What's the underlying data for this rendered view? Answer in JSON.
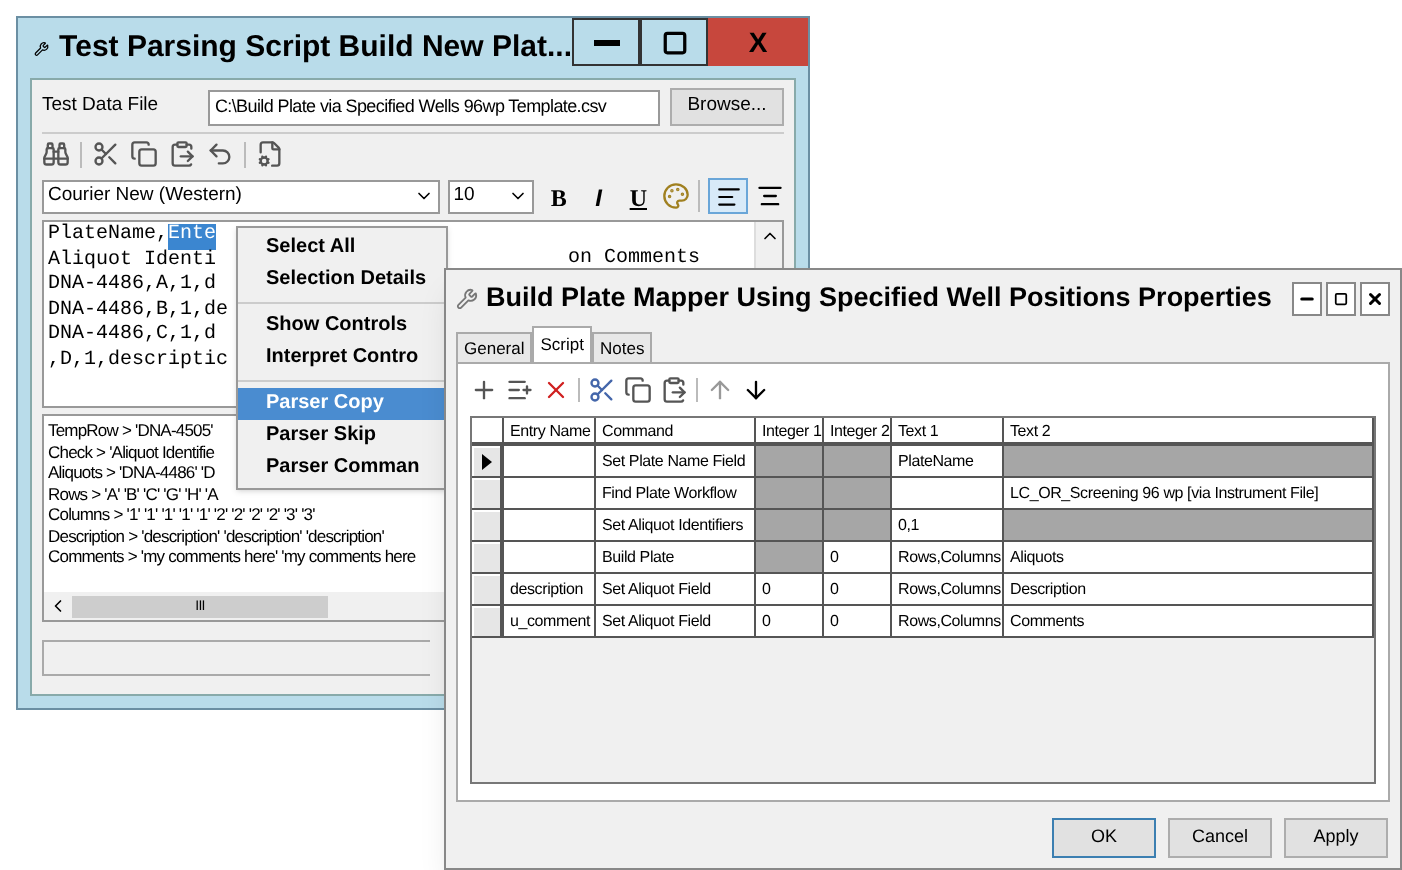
{
  "parser_window": {
    "title": "Test Parsing Script Build New Plat...",
    "close_label": "X",
    "test_data_file": {
      "label": "Test Data File",
      "value": "C:\\Build Plate via Specified Wells 96wp Template.csv",
      "button": "Browse..."
    },
    "font_select": {
      "value": "Courier New (Western)"
    },
    "size_select": {
      "value": "10"
    },
    "format_buttons": [
      {
        "label": "B",
        "kind": "bold"
      },
      {
        "label": "I",
        "kind": "italic"
      },
      {
        "label": "U",
        "kind": "underline"
      }
    ],
    "editor_lines": [
      {
        "text": "PlateName,",
        "selected_text": "Ente"
      },
      {
        "text": "Aliquot Identi"
      },
      {
        "text": "DNA-4486,A,1,d"
      },
      {
        "text": "DNA-4486,B,1,de"
      },
      {
        "text": "DNA-4486,C,1,d"
      },
      {
        "text": ",D,1,descriptic"
      }
    ],
    "editor_overflow_text": "on Comments",
    "log_lines": [
      "TempRow > 'DNA-4505'",
      "Check > 'Aliquot Identifie",
      "Aliquots > 'DNA-4486' 'D",
      "Rows > 'A' 'B' 'C' 'G' 'H' 'A",
      "Columns > '1' '1' '1' '1' '1' '2' '2' '2' '2' '3' '3'",
      "Description > 'description' 'description' 'description'",
      "Comments > 'my comments here' 'my comments here"
    ],
    "scrollbar_grip": "III"
  },
  "context_menu": {
    "groups": [
      [
        {
          "label": "Select All",
          "selected": false
        },
        {
          "label": "Selection Details",
          "selected": false
        }
      ],
      [
        {
          "label": "Show Controls",
          "selected": false
        },
        {
          "label": "Interpret Contro",
          "selected": false
        }
      ],
      [
        {
          "label": "Parser Copy",
          "selected": true
        },
        {
          "label": "Parser Skip",
          "selected": false
        },
        {
          "label": "Parser Comman",
          "selected": false
        }
      ]
    ]
  },
  "properties_dialog": {
    "title": "Build Plate Mapper Using Specified Well Positions Properties",
    "tabs": [
      {
        "label": "General",
        "selected": false
      },
      {
        "label": "Script",
        "selected": true
      },
      {
        "label": "Notes",
        "selected": false
      }
    ],
    "table": {
      "columns": [
        "Entry Name",
        "Command",
        "Integer 1",
        "Integer 2",
        "Text 1",
        "Text 2"
      ],
      "rows": [
        {
          "current": true,
          "cells": [
            {
              "disabled": false
            },
            {
              "text": "Set Plate Name Field",
              "disabled": false
            },
            {
              "disabled": true
            },
            {
              "disabled": true
            },
            {
              "text": "PlateName",
              "disabled": false
            },
            {
              "disabled": true
            }
          ]
        },
        {
          "current": false,
          "cells": [
            {
              "disabled": false
            },
            {
              "text": "Find Plate Workflow",
              "disabled": false
            },
            {
              "disabled": true
            },
            {
              "disabled": true
            },
            {
              "disabled": false
            },
            {
              "text": "LC_OR_Screening 96 wp [via Instrument File]",
              "disabled": false
            }
          ]
        },
        {
          "current": false,
          "cells": [
            {
              "disabled": false
            },
            {
              "text": "Set Aliquot Identifiers",
              "disabled": false
            },
            {
              "disabled": true
            },
            {
              "disabled": true
            },
            {
              "text": "0,1",
              "disabled": false
            },
            {
              "disabled": true
            }
          ]
        },
        {
          "current": false,
          "cells": [
            {
              "disabled": false
            },
            {
              "text": "Build Plate",
              "disabled": false
            },
            {
              "disabled": true
            },
            {
              "text": "0",
              "disabled": false
            },
            {
              "text": "Rows,Columns",
              "disabled": false
            },
            {
              "text": "Aliquots",
              "disabled": false
            }
          ]
        },
        {
          "current": false,
          "cells": [
            {
              "text": "description",
              "disabled": false
            },
            {
              "text": "Set Aliquot Field",
              "disabled": false
            },
            {
              "text": "0",
              "disabled": false
            },
            {
              "text": "0",
              "disabled": false
            },
            {
              "text": "Rows,Columns",
              "disabled": false
            },
            {
              "text": "Description",
              "disabled": false
            }
          ]
        },
        {
          "current": false,
          "cells": [
            {
              "text": "u_comment",
              "disabled": false
            },
            {
              "text": "Set Aliquot Field",
              "disabled": false
            },
            {
              "text": "0",
              "disabled": false
            },
            {
              "text": "0",
              "disabled": false
            },
            {
              "text": "Rows,Columns",
              "disabled": false
            },
            {
              "text": "Comments",
              "disabled": false
            }
          ]
        }
      ]
    },
    "buttons": [
      "OK",
      "Cancel",
      "Apply"
    ]
  }
}
